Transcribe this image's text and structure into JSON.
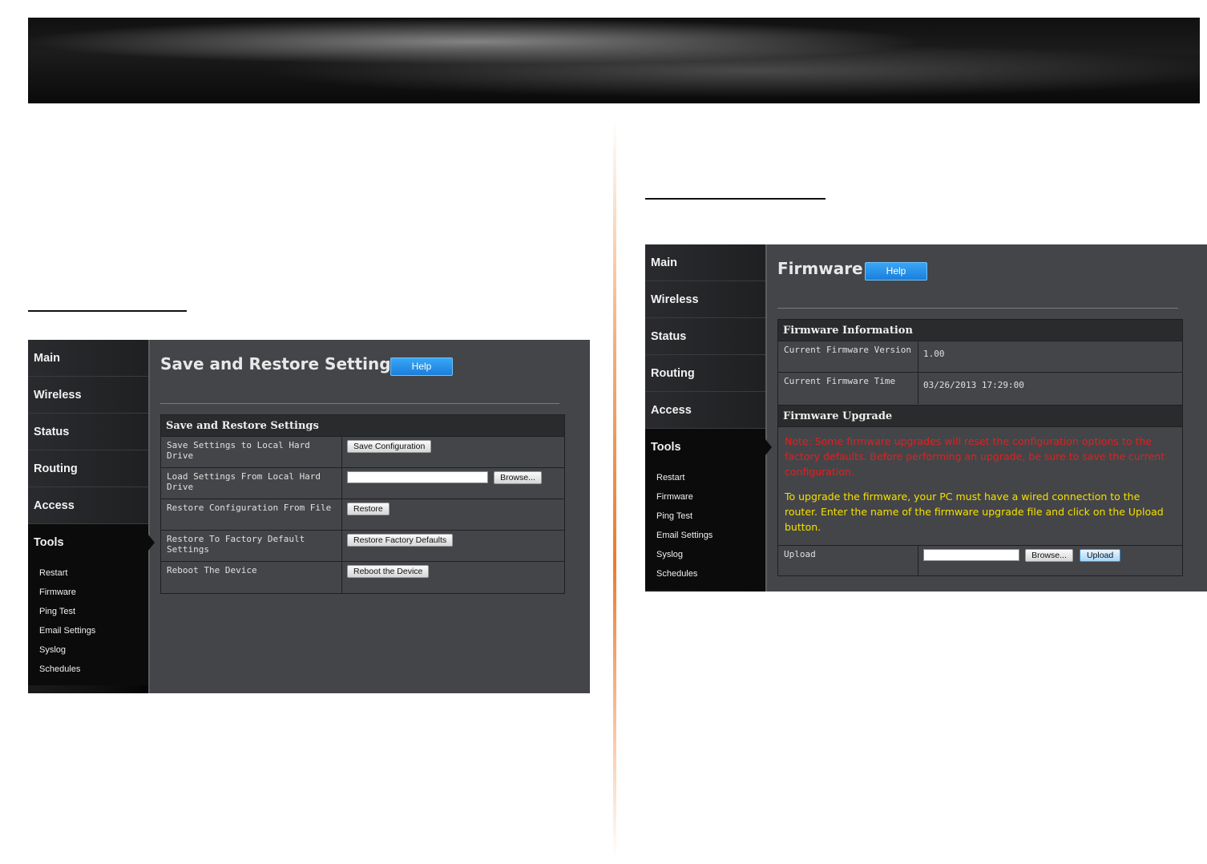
{
  "sidebar": {
    "main_items": [
      "Main",
      "Wireless",
      "Status",
      "Routing",
      "Access"
    ],
    "active_item": "Tools",
    "tools_subitems": [
      "Restart",
      "Firmware",
      "Ping Test",
      "Email Settings",
      "Syslog",
      "Schedules"
    ]
  },
  "save_restore": {
    "title": "Save and Restore Settings",
    "help_label": "Help",
    "table_title": "Save and Restore Settings",
    "rows": {
      "save_label": "Save Settings to Local Hard Drive",
      "save_button": "Save Configuration",
      "load_label": "Load Settings From Local Hard Drive",
      "browse_button": "Browse...",
      "restore_label": "Restore Configuration From File",
      "restore_button": "Restore",
      "factory_label": "Restore To Factory Default Settings",
      "factory_button": "Restore Factory Defaults",
      "reboot_label": "Reboot The Device",
      "reboot_button": "Reboot the Device"
    }
  },
  "firmware": {
    "title": "Firmware",
    "help_label": "Help",
    "info_title": "Firmware Information",
    "version_label": "Current Firmware Version",
    "version_value": "1.00",
    "time_label": "Current Firmware Time",
    "time_value": "03/26/2013 17:29:00",
    "upgrade_title": "Firmware Upgrade",
    "note_red": "Note: Some firmware upgrades will reset the configuration options to the factory defaults. Before performing an upgrade, be sure to save the current configuration.",
    "note_yellow": "To upgrade the firmware, your PC must have a wired connection to the router. Enter the name of the firmware upgrade file and click on the Upload button.",
    "upload_label": "Upload",
    "browse_button": "Browse...",
    "upload_button": "Upload"
  }
}
